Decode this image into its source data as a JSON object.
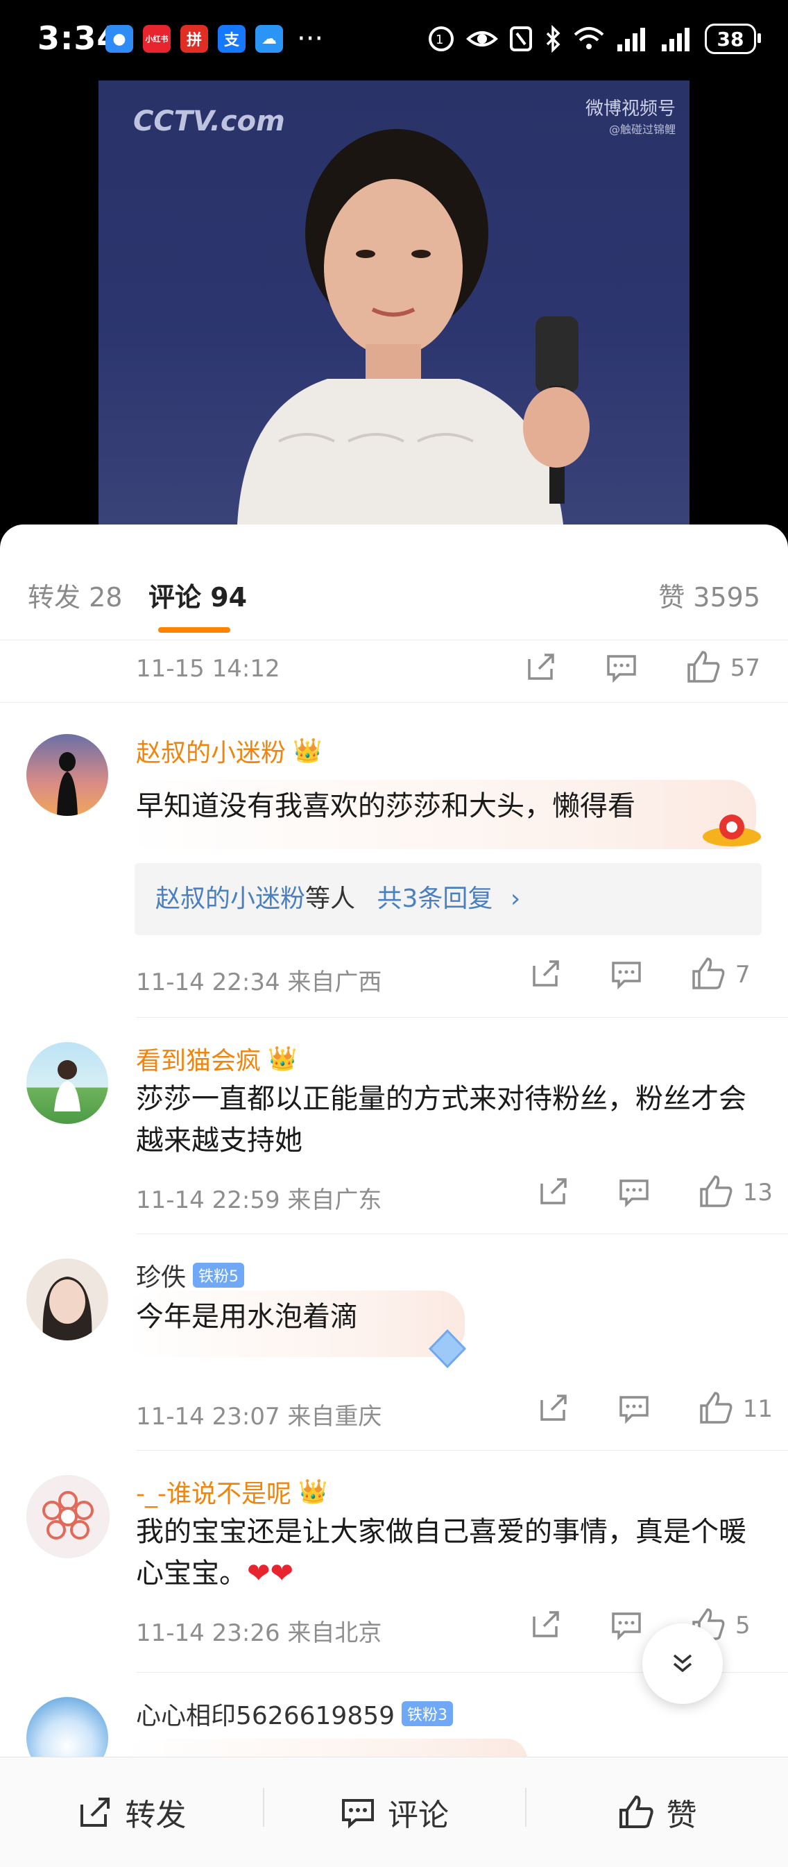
{
  "status_bar": {
    "time": "3:34",
    "apps": [
      {
        "icon": "chat-app-icon",
        "color": "#2f8cf5",
        "glyph": "●"
      },
      {
        "icon": "xiaohongshu-icon",
        "color": "#e8242f",
        "glyph": "小红书"
      },
      {
        "icon": "pinduoduo-icon",
        "color": "#e02e24",
        "glyph": "拼"
      },
      {
        "icon": "alipay-icon",
        "color": "#1677ff",
        "glyph": "支"
      },
      {
        "icon": "cloud-app-icon",
        "color": "#2a95f7",
        "glyph": "☁"
      }
    ],
    "more": "···",
    "battery": "38"
  },
  "video": {
    "channel_watermark": "CCTV.com",
    "platform_watermark": "微博视频号",
    "platform_handle": "@触碰过锦鲤"
  },
  "tabs": {
    "repost": "转发 28",
    "comments": "评论 94",
    "likes": "赞 3595"
  },
  "comments": [
    {
      "name": "",
      "text": "",
      "time": "11-15 14:12",
      "likes": "57"
    },
    {
      "name": "赵叔的小迷粉",
      "badge": "crown",
      "text": "早知道没有我喜欢的莎莎和大头，懒得看",
      "time": "11-14 22:34 来自广西",
      "likes": "7",
      "replies": {
        "user": "赵叔的小迷粉",
        "middle": "等人",
        "count": "共3条回复"
      }
    },
    {
      "name": "看到猫会疯",
      "badge": "crown",
      "text": "莎莎一直都以正能量的方式来对待粉丝，粉丝才会越来越支持她",
      "time": "11-14 22:59 来自广东",
      "likes": "13"
    },
    {
      "name": "珍佚",
      "badge": "铁粉5",
      "text": "今年是用水泡着滴",
      "time": "11-14 23:07 来自重庆",
      "likes": "11"
    },
    {
      "name": "-_-谁说不是呢",
      "badge": "crown",
      "text": "我的宝宝还是让大家做自己喜爱的事情，真是个暖心宝宝。❤❤",
      "time": "11-14 23:26 来自北京",
      "likes": "5"
    },
    {
      "name": "心心相印5626619859",
      "badge": "铁粉3",
      "text": "",
      "time": "",
      "likes": ""
    }
  ],
  "bottom_bar": {
    "repost": "转发",
    "comment": "评论",
    "like": "赞"
  },
  "colors": {
    "accent": "#ff8200",
    "username": "#f0840c",
    "link": "#4a7fc0",
    "heart": "#e8242f"
  }
}
